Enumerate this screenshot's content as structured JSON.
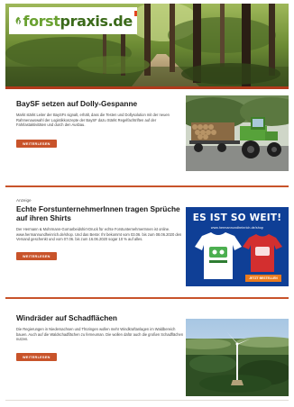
{
  "header": {
    "logo_text_a": "forst",
    "logo_text_b": "praxis.de"
  },
  "articles": [
    {
      "title": "BaySF setzen auf Dolly-Gespanne",
      "body": "Markt stärkt Leiter der BaySFs signalt, erhält, dass die Testen und Dollysolution mit der neuen Rahmenauswahl der Logistikkonzepte der BaySF dazu Stärkt Regelfachtriften auf der Fahrlastaktivitäten und durch den Ausbau.",
      "button": "WEITERLESEN",
      "image_alt_icon": "tractor-timber-photo"
    },
    {
      "overline": "Anzeige",
      "title": "Echte ForstunternehmerInnen tragen Sprüche auf ihren Shirts",
      "body": "Der Hermann & Mohrmann-Gornarbeidshirt-Druck für echte ForstunternehmerInnen ist online. www.hermannundheinrich.de/shop. Und das Beste: Ihr bekommt vom 03.06. bis zum 08.06.2020 den Versand geschenkt und vom 07.06. bis zum 16.06.2020 sogar 10 % auf alles.",
      "button": "WEITERLESEN",
      "ad": {
        "headline": "ES IST SO WEIT!",
        "url": "www.hermannundheinrich.de/shop",
        "cta": "JETZT BESTELLEN"
      }
    },
    {
      "title": "Windräder auf Schadflächen",
      "body": "Die Regierungen in Niedersachsen und Thüringen wollen mehr Windkraftanlagen im Waldbereich bauen. Auch auf die Waldschadflächen zu ferneuman. Die wollen dafür auch die großen Schadflächen nutzen.",
      "button": "WEITERLESEN",
      "image_alt_icon": "wind-turbine-forest-photo"
    }
  ],
  "colors": {
    "accent": "#c8532a",
    "header_bar": "#b13a1b",
    "logo_green": "#6aa131",
    "logo_dark_green": "#3b6a1a",
    "ad_blue": "#0f3f96",
    "ad_orange": "#ea7a1c"
  }
}
